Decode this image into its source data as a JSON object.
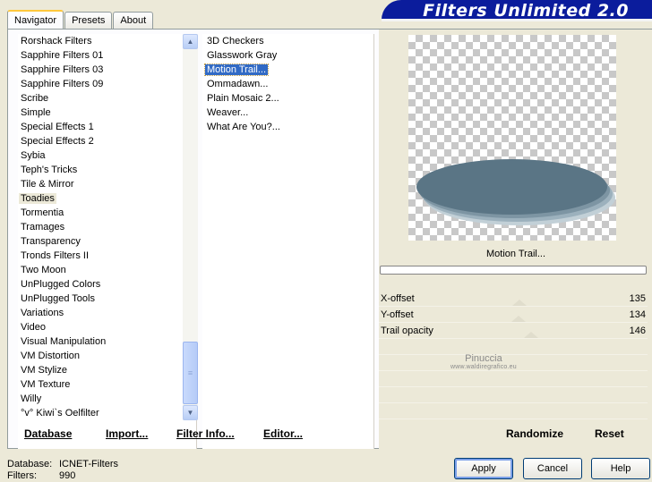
{
  "tabs": [
    {
      "label": "Navigator",
      "active": true
    },
    {
      "label": "Presets",
      "active": false
    },
    {
      "label": "About",
      "active": false
    }
  ],
  "banner": {
    "title": "Filters Unlimited 2.0"
  },
  "categories": {
    "items": [
      "Rorshack Filters",
      "Sapphire Filters 01",
      "Sapphire Filters 03",
      "Sapphire Filters 09",
      "Scribe",
      "Simple",
      "Special Effects 1",
      "Special Effects 2",
      "Sybia",
      "Teph's Tricks",
      "Tile & Mirror",
      "Toadies",
      "Tormentia",
      "Tramages",
      "Transparency",
      "Tronds Filters II",
      "Two Moon",
      "UnPlugged Colors",
      "UnPlugged Tools",
      "Variations",
      "Video",
      "Visual Manipulation",
      "VM Distortion",
      "VM Stylize",
      "VM Texture",
      "Willy",
      "°v° Kiwi`s Oelfilter"
    ],
    "selected": "Toadies"
  },
  "filters": {
    "items": [
      "3D Checkers",
      "Glasswork Gray",
      "Motion Trail...",
      "Ommadawn...",
      "Plain Mosaic 2...",
      "Weaver...",
      "What Are You?..."
    ],
    "selected": "Motion Trail..."
  },
  "preview": {
    "filter_name": "Motion Trail...",
    "shape_color": "#5a7585"
  },
  "sliders": [
    {
      "label": "X-offset",
      "value": "135"
    },
    {
      "label": "Y-offset",
      "value": "134"
    },
    {
      "label": "Trail opacity",
      "value": "146"
    }
  ],
  "watermark": {
    "line1": "Pinuccia",
    "line2": "www.waldiregrafico.eu"
  },
  "bottom": {
    "database": "Database",
    "import": "Import...",
    "filter_info": "Filter Info...",
    "editor": "Editor...",
    "randomize": "Randomize",
    "reset": "Reset"
  },
  "status": {
    "database_label": "Database:",
    "database_value": "ICNET-Filters",
    "filters_label": "Filters:",
    "filters_value": "990"
  },
  "dialog_buttons": {
    "apply": "Apply",
    "cancel": "Cancel",
    "help": "Help"
  },
  "colors": {
    "banner": "#0b1c9c",
    "selection": "#316ac5"
  }
}
